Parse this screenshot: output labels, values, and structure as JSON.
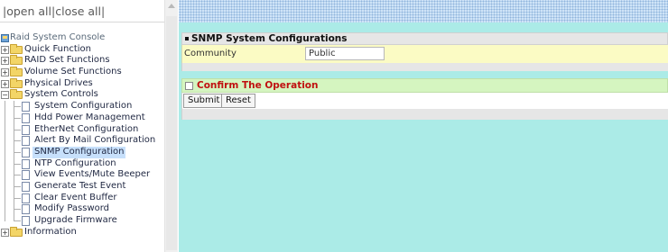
{
  "tree_top": {
    "open_all": "open all",
    "close_all": "close all",
    "sep": "|"
  },
  "tree": {
    "root": "Raid System Console",
    "folders": [
      "Quick Function",
      "RAID Set Functions",
      "Volume Set Functions",
      "Physical Drives",
      "System Controls"
    ],
    "system_controls_items": [
      "System Configuration",
      "Hdd Power Management",
      "EtherNet Configuration",
      "Alert By Mail Configuration",
      "SNMP Configuration",
      "NTP Configuration",
      "View Events/Mute Beeper",
      "Generate Test Event",
      "Clear Event Buffer",
      "Modify Password",
      "Upgrade Firmware"
    ],
    "last_folder": "Information",
    "selected": "SNMP Configuration"
  },
  "form": {
    "section_title": "SNMP System Configurations",
    "community_label": "Community",
    "community_value": "Public",
    "confirm_label": "Confirm The Operation",
    "submit_label": "Submit",
    "reset_label": "Reset"
  },
  "colors": {
    "content_bg": "#abebe7",
    "confirm_text": "#c01010",
    "selected_bg": "#c7e0fb"
  }
}
